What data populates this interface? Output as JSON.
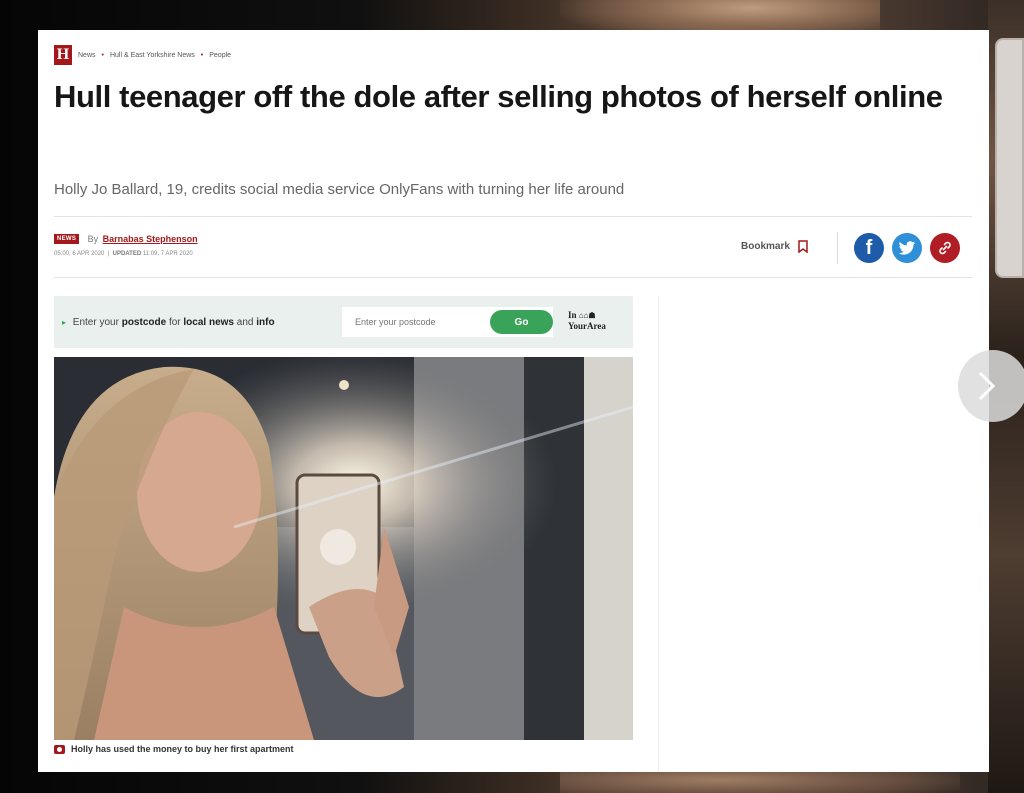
{
  "breadcrumb": {
    "logo": "H",
    "items": [
      "News",
      "Hull & East Yorkshire News",
      "People"
    ],
    "separator": "•"
  },
  "article": {
    "headline": "Hull teenager off the dole after selling photos of herself online",
    "standfirst": "Holly Jo Ballard, 19, credits social media service OnlyFans with turning her life around",
    "badge": "NEWS",
    "by_label": "By",
    "author": "Barnabas Stephenson",
    "published": "05:00, 6 APR 2020",
    "updated_label": "UPDATED",
    "updated": "11:09, 7 APR 2020"
  },
  "actions": {
    "bookmark_label": "Bookmark",
    "social": [
      "facebook-share",
      "twitter-share",
      "copy-link"
    ]
  },
  "postcode": {
    "prefix": "Enter your",
    "bold1": "postcode",
    "mid1": "for",
    "bold2": "local news",
    "mid2": "and",
    "bold3": "info",
    "placeholder": "Enter your postcode",
    "button": "Go",
    "brand_line1": "In",
    "brand_line2": "YourArea"
  },
  "photo": {
    "caption": "Holly has used the money to buy her first apartment"
  },
  "colors": {
    "brand": "#a3181b",
    "go": "#3aa35a",
    "facebook": "#1e5ba8",
    "twitter": "#2f8fd8"
  }
}
